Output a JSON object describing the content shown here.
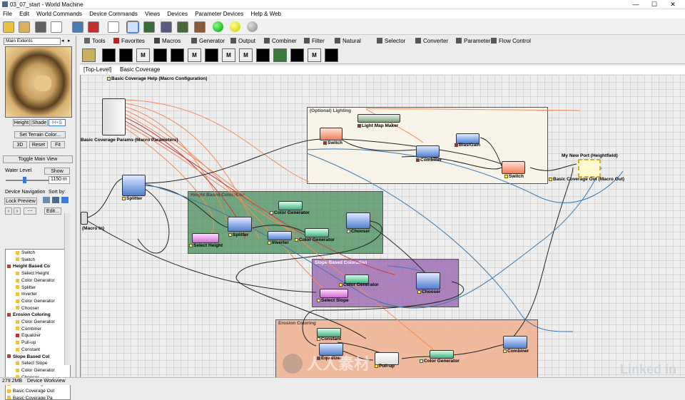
{
  "window": {
    "title": "03_07_start - World Machine",
    "minimize": "—",
    "maximize": "☐",
    "close": "✕"
  },
  "menu": [
    "File",
    "Edit",
    "World Commands",
    "Device Commands",
    "Views",
    "Devices",
    "Parameter Devices",
    "Help & Web"
  ],
  "left": {
    "extents_select": "Main Extents",
    "view_modes": [
      "Height",
      "Shade",
      "H+S"
    ],
    "set_terrain_color": "Set Terrain Color...",
    "view_buttons": [
      "3D",
      "Reset",
      "Fit"
    ],
    "toggle_main_view": "Toggle Main View",
    "water_level_label": "Water Level",
    "show_button": "Show",
    "water_value": "1150 m",
    "device_nav_label": "Device Navigation",
    "sort_by_label": "Sort by:",
    "lock_preview": "Lock Preview",
    "edit_button": "Edit...",
    "tree": [
      {
        "label": "Switch",
        "level": 2,
        "color": "#f0c040"
      },
      {
        "label": "Switch",
        "level": 2,
        "color": "#f0c040"
      },
      {
        "label": "Height Based Co",
        "level": 1,
        "color": "#b04040",
        "bold": true
      },
      {
        "label": "Select Height",
        "level": 2,
        "color": "#f0c040"
      },
      {
        "label": "Color Generator",
        "level": 2,
        "color": "#f0c040"
      },
      {
        "label": "Splitter",
        "level": 2,
        "color": "#f0c040"
      },
      {
        "label": "Inverter",
        "level": 2,
        "color": "#f0c040"
      },
      {
        "label": "Color Generator",
        "level": 2,
        "color": "#f0c040"
      },
      {
        "label": "Chooser",
        "level": 2,
        "color": "#f0c040"
      },
      {
        "label": "Erosion Coloring",
        "level": 1,
        "color": "#b04040",
        "bold": true
      },
      {
        "label": "Color Generator",
        "level": 2,
        "color": "#f0c040"
      },
      {
        "label": "Combiner",
        "level": 2,
        "color": "#f0c040"
      },
      {
        "label": "Equalizer",
        "level": 2,
        "color": "#c03030"
      },
      {
        "label": "Pull-up",
        "level": 2,
        "color": "#f0c040"
      },
      {
        "label": "Constant",
        "level": 2,
        "color": "#f0c040"
      },
      {
        "label": "Slope Based Col",
        "level": 1,
        "color": "#b04040",
        "bold": true
      },
      {
        "label": "Select Slope",
        "level": 2,
        "color": "#f0c040"
      },
      {
        "label": "Color Generator",
        "level": 2,
        "color": "#f0c040"
      },
      {
        "label": "Chooser",
        "level": 2,
        "color": "#f0c040"
      },
      {
        "label": "Basic Coverage In",
        "level": 1,
        "color": "#f0c040"
      },
      {
        "label": "Basic Coverage Out",
        "level": 1,
        "color": "#f0c040"
      },
      {
        "label": "Basic Coverage Pa",
        "level": 1,
        "color": "#f0c040"
      }
    ]
  },
  "categories": [
    {
      "label": "Tools",
      "color": "#666"
    },
    {
      "label": "Favorites",
      "color": "#c02020"
    },
    {
      "label": "Macros",
      "color": "#444"
    },
    {
      "label": "Generator",
      "color": "#555"
    },
    {
      "label": "Output",
      "color": "#555"
    },
    {
      "label": "Combiner",
      "color": "#555"
    },
    {
      "label": "Filter",
      "color": "#555"
    },
    {
      "label": "Natural",
      "color": "#555"
    },
    {
      "label": "Selector",
      "color": "#555"
    },
    {
      "label": "Converter",
      "color": "#555"
    },
    {
      "label": "Parameter",
      "color": "#555"
    },
    {
      "label": "Flow Control",
      "color": "#555"
    }
  ],
  "devices": [
    "",
    "",
    "M",
    "",
    "",
    "M",
    "",
    "M",
    "M",
    "",
    "",
    "",
    "M",
    ""
  ],
  "breadcrumb": {
    "level": "[Top-Level]",
    "name": "Basic Coverage"
  },
  "canvas": {
    "help_label": "Basic Coverage Help (Macro Configuration)",
    "regions": [
      {
        "name": "optional-lighting",
        "label": "(Optional) Lighting"
      },
      {
        "name": "height-based",
        "label": "Height Based Coloration"
      },
      {
        "name": "slope-based",
        "label": "Slope Based Coloration"
      },
      {
        "name": "erosion",
        "label": "Erosion Coloring"
      }
    ],
    "nodes": {
      "params": "Basic Coverage Params (Macro Parameters)",
      "macro_in": "(Macro In)",
      "splitter1": "Splitter",
      "light_map": "Light Map Maker",
      "switch1": "Switch",
      "combiner1": "Combiner",
      "bias_gain": "Bias/Gain",
      "switch2": "Switch",
      "port": "My New Port (Heightfield)",
      "macro_out": "Basic Coverage Out (Macro Out)",
      "select_height": "Select Height",
      "splitter2": "Splitter",
      "colorgen1": "Color Generator",
      "inverter": "Inverter",
      "colorgen2": "Color Generator",
      "chooser1": "Chooser",
      "colorgen3": "Color Generator",
      "select_slope": "Select Slope",
      "chooser2": "Chooser",
      "constant": "Constant",
      "equalizer": "Equalizer",
      "pullup": "Pull-up",
      "colorgen4": "Color Generator",
      "combiner2": "Combiner"
    }
  },
  "status": {
    "memory": "279.2MB",
    "view": "Device Workview"
  },
  "brand": "Linked in"
}
